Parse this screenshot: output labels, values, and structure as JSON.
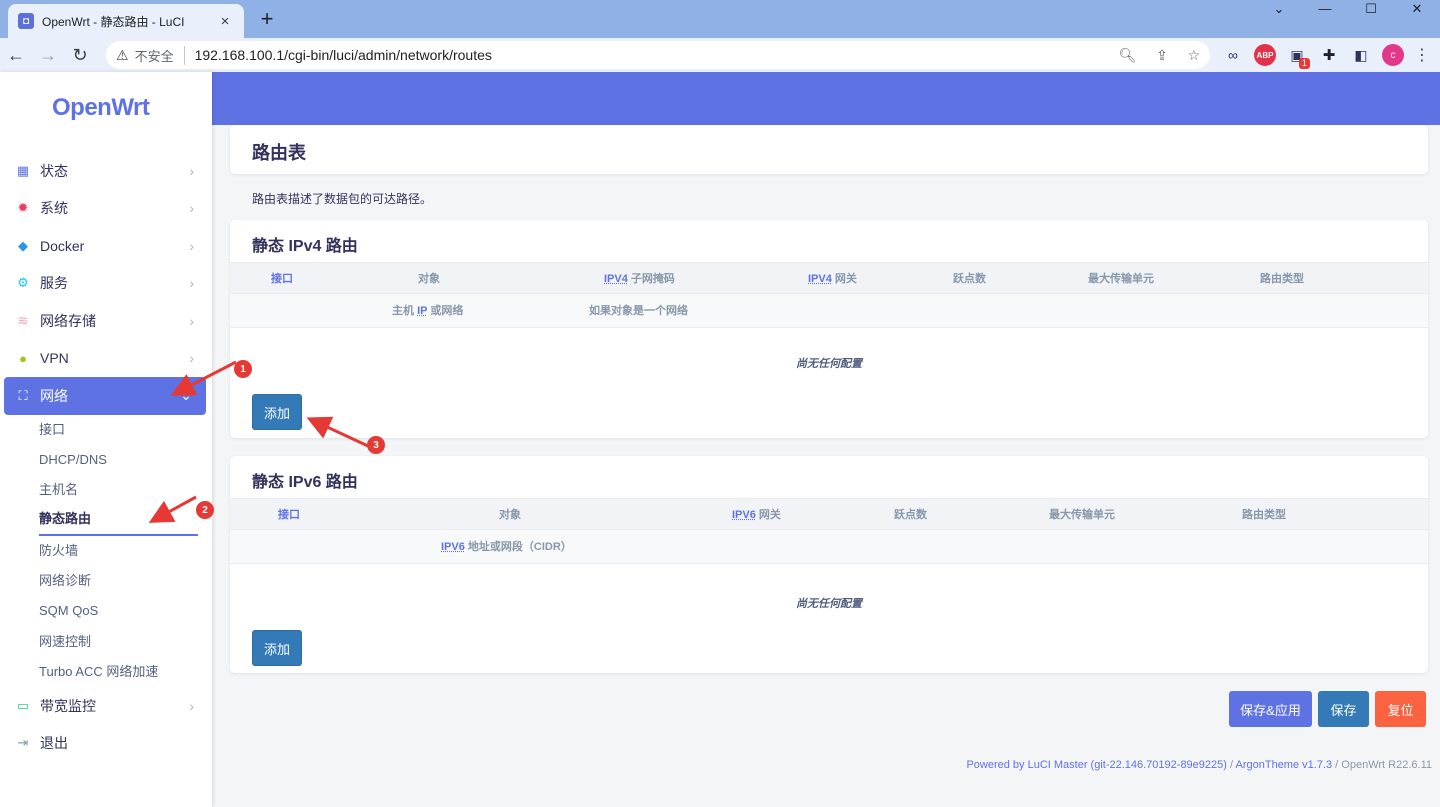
{
  "browser": {
    "tab_title": "OpenWrt - 静态路由 - LuCI",
    "tab_favicon": "openwrt-favicon",
    "new_tab": "+",
    "insecure_label": "不安全",
    "url": "192.168.100.1/cgi-bin/luci/admin/network/routes",
    "profile_initial": "c",
    "ext_badge": "1",
    "ext_abp": "ABP"
  },
  "sidebar": {
    "logo": "OpenWrt",
    "items": [
      {
        "label": "状态",
        "icon": "dashboard-icon",
        "color": "#5e72e4"
      },
      {
        "label": "系统",
        "icon": "gear-icon",
        "color": "#f5365c"
      },
      {
        "label": "Docker",
        "icon": "docker-icon",
        "color": "#2496ed"
      },
      {
        "label": "服务",
        "icon": "cogs-icon",
        "color": "#11cdef"
      },
      {
        "label": "网络存储",
        "icon": "database-icon",
        "color": "#f3a4b5"
      },
      {
        "label": "VPN",
        "icon": "vpn-icon",
        "color": "#2dce89"
      },
      {
        "label": "网络",
        "icon": "network-icon",
        "color": "#ffffff"
      }
    ],
    "network_sub": [
      "接口",
      "DHCP/DNS",
      "主机名",
      "静态路由",
      "防火墙",
      "网络诊断",
      "SQM QoS",
      "网速控制",
      "Turbo ACC 网络加速"
    ],
    "after_items": [
      {
        "label": "带宽监控",
        "icon": "monitor-icon",
        "color": "#2dce89"
      },
      {
        "label": "退出",
        "icon": "logout-icon",
        "color": "#8898aa"
      }
    ]
  },
  "main": {
    "page_title": "路由表",
    "description": "路由表描述了数据包的可达路径。",
    "ipv4": {
      "title": "静态 IPv4 路由",
      "headers": {
        "iface": "接口",
        "target": "对象",
        "mask_abbr": "IPV4",
        "mask_rest": "子网掩码",
        "gw_abbr": "IPV4",
        "gw_rest": "网关",
        "metric": "跃点数",
        "mtu": "最大传输单元",
        "type": "路由类型"
      },
      "sub_target_pre": "主机",
      "sub_target_abbr": "IP",
      "sub_target_post": "或网络",
      "sub_mask": "如果对象是一个网络",
      "empty": "尚无任何配置",
      "add": "添加"
    },
    "ipv6": {
      "title": "静态 IPv6 路由",
      "headers": {
        "iface": "接口",
        "target": "对象",
        "gw_abbr": "IPV6",
        "gw_rest": "网关",
        "metric": "跃点数",
        "mtu": "最大传输单元",
        "type": "路由类型"
      },
      "sub_target_abbr": "IPV6",
      "sub_target_post": "地址或网段（CIDR）",
      "empty": "尚无任何配置",
      "add": "添加"
    },
    "actions": {
      "save_apply": "保存&应用",
      "save": "保存",
      "reset": "复位"
    },
    "colors": {
      "save_apply": "#5e72e4",
      "save": "#337ab7",
      "reset": "#fb6340"
    }
  },
  "footer": {
    "powered": "Powered by LuCI Master (git-22.146.70192-89e9225)",
    "sep1": " / ",
    "theme": "ArgonTheme v1.7.3",
    "sep2": " / ",
    "version": "OpenWrt R22.6.11"
  },
  "annotations": [
    "1",
    "2",
    "3"
  ]
}
